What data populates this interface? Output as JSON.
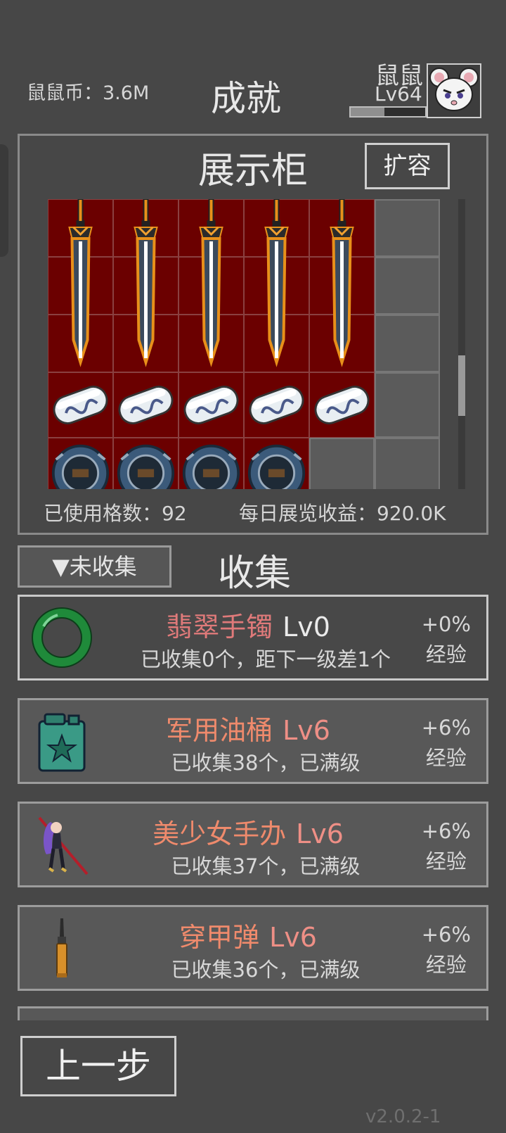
{
  "header": {
    "coins_text": "鼠鼠币：3.6M",
    "title": "成就",
    "player_name": "鼠鼠",
    "player_level": "Lv64",
    "exp_progress": 0.45
  },
  "showcase": {
    "title": "展示柜",
    "expand_label": "扩容",
    "used_slots_text": "已使用格数：92",
    "daily_income_text": "每日展览收益：920.0K",
    "rows": [
      {
        "item": "sword-icon",
        "filled": 5,
        "empty": 1
      },
      {
        "item": "sword-icon",
        "filled": 5,
        "empty": 1
      },
      {
        "item": "sword-icon",
        "filled": 5,
        "empty": 1
      },
      {
        "item": "pill-capsule-icon",
        "filled": 5,
        "empty": 1
      },
      {
        "item": "watch-icon",
        "filled": 4,
        "empty": 2
      }
    ],
    "scroll_position": 0.55
  },
  "collection": {
    "filter_label": "▼未收集",
    "title": "收集",
    "items": [
      {
        "icon": "jade-bracelet-icon",
        "name": "翡翠手镯",
        "level": "Lv0",
        "progress": "已收集0个，距下一级差1个",
        "bonus": "+0%",
        "bonus_label": "经验"
      },
      {
        "icon": "jerry-can-icon",
        "name": "军用油桶",
        "level": "Lv6",
        "progress": "已收集38个，已满级",
        "bonus": "+6%",
        "bonus_label": "经验"
      },
      {
        "icon": "anime-figure-icon",
        "name": "美少女手办",
        "level": "Lv6",
        "progress": "已收集37个，已满级",
        "bonus": "+6%",
        "bonus_label": "经验"
      },
      {
        "icon": "armor-piercing-bullet-icon",
        "name": "穿甲弹",
        "level": "Lv6",
        "progress": "已收集36个，已满级",
        "bonus": "+6%",
        "bonus_label": "经验"
      }
    ]
  },
  "footer": {
    "back_label": "上一步",
    "version": "v2.0.2-1"
  }
}
